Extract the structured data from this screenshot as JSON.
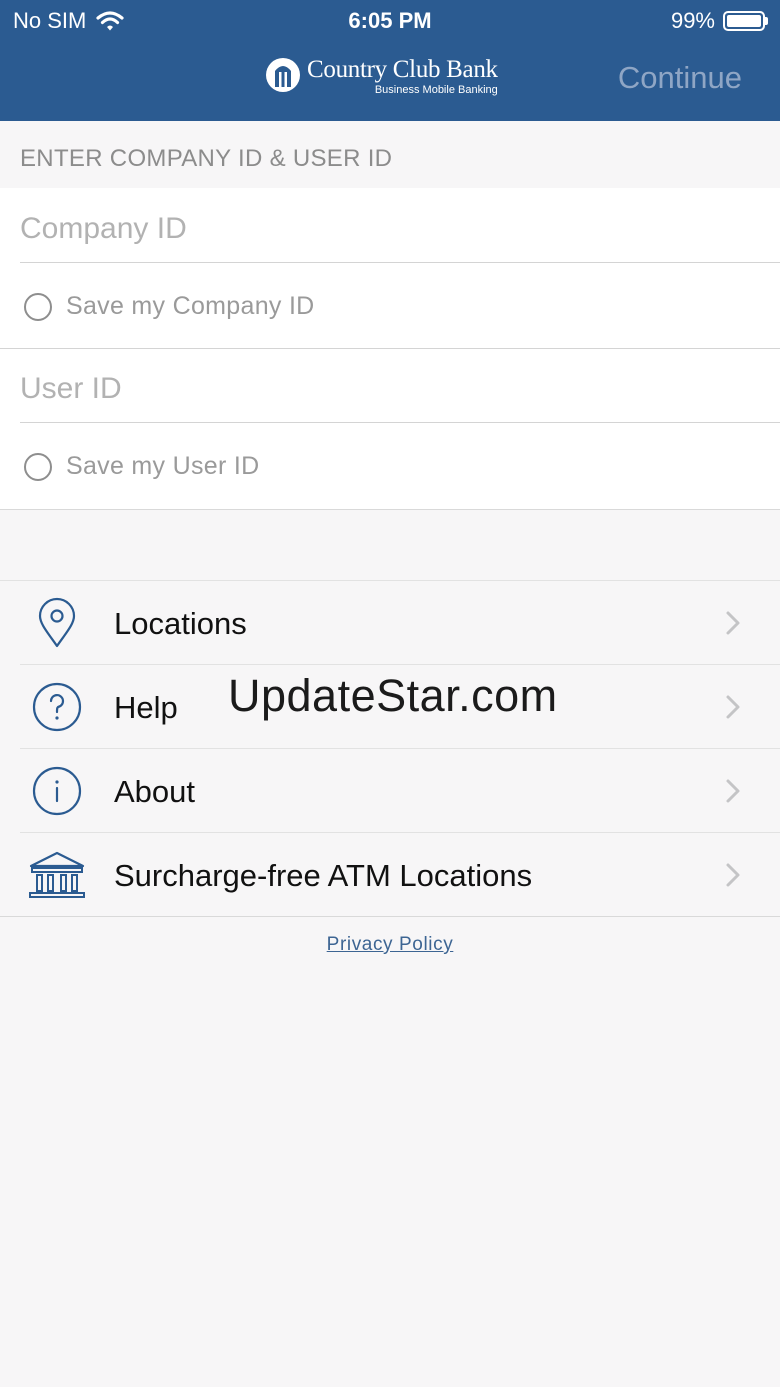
{
  "status_bar": {
    "carrier": "No SIM",
    "time": "6:05 PM",
    "battery": "99%",
    "battery_level": 0.99
  },
  "header": {
    "brand_name": "Country Club Bank",
    "brand_subtitle": "Business Mobile Banking",
    "continue_label": "Continue",
    "background_color": "#2b5b91"
  },
  "form": {
    "section_label": "ENTER COMPANY ID & USER ID",
    "company_id": {
      "placeholder": "Company ID",
      "value": ""
    },
    "save_company_id": {
      "label": "Save my Company ID",
      "checked": false
    },
    "user_id": {
      "placeholder": "User ID",
      "value": ""
    },
    "save_user_id": {
      "label": "Save my User ID",
      "checked": false
    }
  },
  "menu": {
    "items": [
      {
        "label": "Locations",
        "icon": "location-pin-icon"
      },
      {
        "label": "Help",
        "icon": "question-circle-icon"
      },
      {
        "label": "About",
        "icon": "info-circle-icon"
      },
      {
        "label": "Surcharge-free ATM Locations",
        "icon": "bank-building-icon"
      }
    ],
    "icon_color": "#2b5b91"
  },
  "watermark": "UpdateStar.com",
  "footer": {
    "privacy_link": "Privacy Policy"
  }
}
